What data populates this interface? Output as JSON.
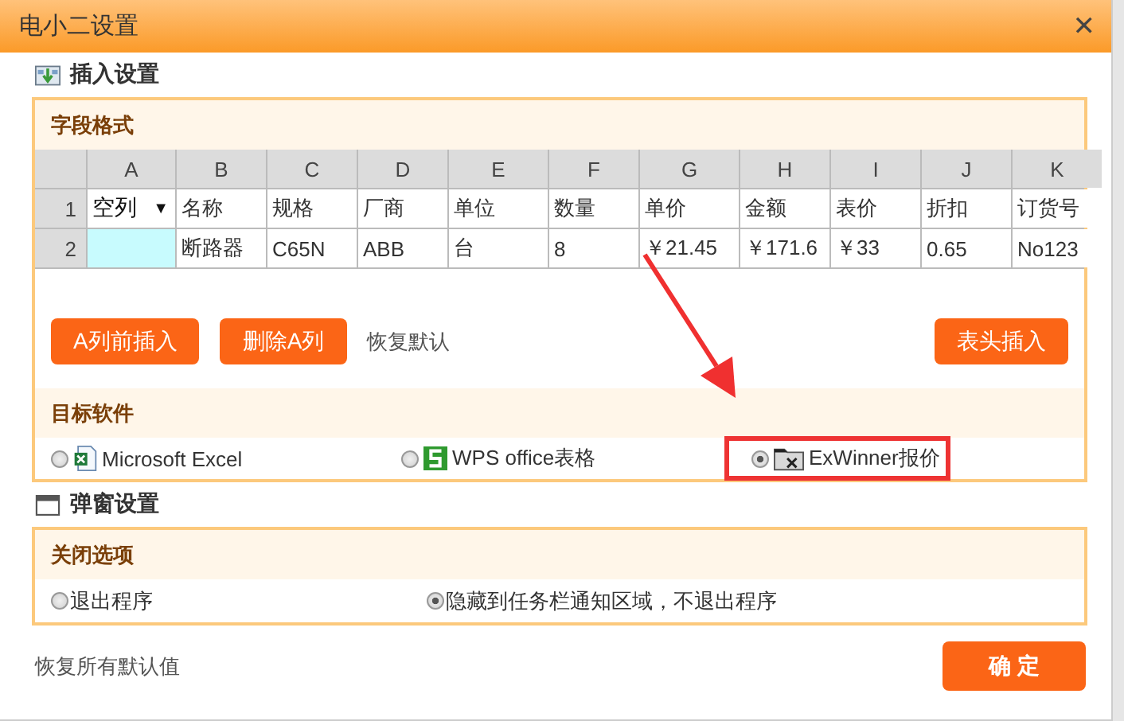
{
  "window": {
    "title": "电小二设置",
    "close": "✕"
  },
  "insert_settings": {
    "title": "插入设置",
    "field_format": {
      "title": "字段格式",
      "columns": [
        "A",
        "B",
        "C",
        "D",
        "E",
        "F",
        "G",
        "H",
        "I",
        "J",
        "K"
      ],
      "rows": [
        {
          "number": "1",
          "cells": [
            {
              "kind": "dropdown",
              "text": "空列",
              "caret": "▼"
            },
            {
              "kind": "text",
              "text": "名称"
            },
            {
              "kind": "text",
              "text": "规格"
            },
            {
              "kind": "text",
              "text": "厂商"
            },
            {
              "kind": "text",
              "text": "单位"
            },
            {
              "kind": "text",
              "text": "数量"
            },
            {
              "kind": "text",
              "text": "单价"
            },
            {
              "kind": "text",
              "text": "金额"
            },
            {
              "kind": "text",
              "text": "表价"
            },
            {
              "kind": "text",
              "text": "折扣"
            },
            {
              "kind": "text",
              "text": "订货号"
            }
          ]
        },
        {
          "number": "2",
          "cells": [
            {
              "kind": "active"
            },
            {
              "kind": "text",
              "text": "断路器"
            },
            {
              "kind": "text",
              "text": "C65N"
            },
            {
              "kind": "text",
              "text": "ABB"
            },
            {
              "kind": "text",
              "text": "台"
            },
            {
              "kind": "text",
              "text": "8"
            },
            {
              "kind": "text",
              "text": "￥21.45"
            },
            {
              "kind": "text",
              "text": "￥171.6"
            },
            {
              "kind": "text",
              "text": "￥33"
            },
            {
              "kind": "text",
              "text": "0.65"
            },
            {
              "kind": "text",
              "text": "No123"
            }
          ]
        }
      ],
      "buttons": [
        "A列前插入",
        "删除A列"
      ],
      "reset_link": "恢复默认",
      "header_button": "表头插入"
    },
    "target_software": {
      "title": "目标软件",
      "options": [
        {
          "label": "Microsoft Excel",
          "selected": false,
          "highlighted": false
        },
        {
          "label": "WPS office表格",
          "selected": false,
          "highlighted": false
        },
        {
          "label": "ExWinner报价",
          "selected": true,
          "highlighted": true
        }
      ]
    }
  },
  "popup_settings": {
    "title": "弹窗设置",
    "close_options": {
      "title": "关闭选项",
      "options": [
        {
          "label": "退出程序",
          "selected": false
        },
        {
          "label": "隐藏到任务栏通知区域，不退出程序",
          "selected": true
        }
      ]
    }
  },
  "footer": {
    "reset_all": "恢复所有默认值",
    "ok_button": "确  定"
  }
}
